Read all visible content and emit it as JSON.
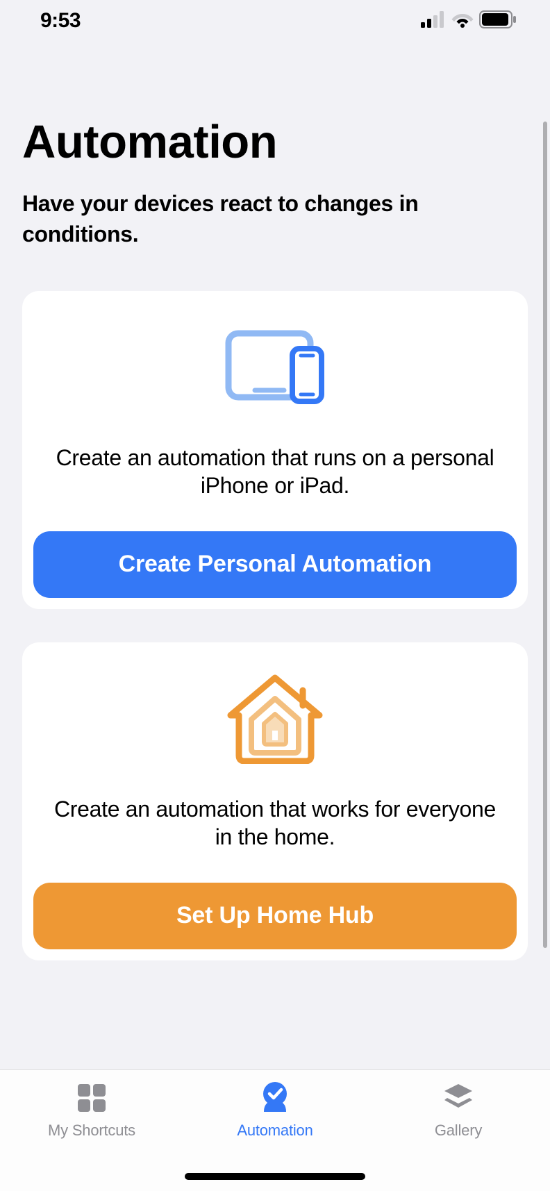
{
  "status": {
    "time": "9:53"
  },
  "header": {
    "title": "Automation",
    "subtitle": "Have your devices react to changes in conditions."
  },
  "cards": {
    "personal": {
      "desc": "Create an automation that runs on a personal iPhone or iPad.",
      "button": "Create Personal Automation"
    },
    "home": {
      "desc": "Create an automation that works for everyone in the home.",
      "button": "Set Up Home Hub"
    }
  },
  "tabs": {
    "shortcuts": "My Shortcuts",
    "automation": "Automation",
    "gallery": "Gallery"
  },
  "colors": {
    "blue": "#3478f6",
    "orange": "#ee9834",
    "gray": "#8e8e93"
  }
}
